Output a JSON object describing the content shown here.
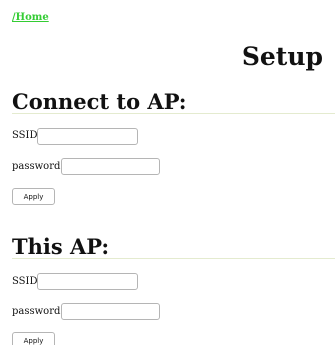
{
  "nav": {
    "home_link": "/Home"
  },
  "page": {
    "title": "Setup"
  },
  "sections": [
    {
      "heading": "Connect to AP:",
      "ssid_label": "SSID:",
      "ssid_value": "",
      "password_label": "password:",
      "password_value": "",
      "apply_label": "Apply"
    },
    {
      "heading": "This AP:",
      "ssid_label": "SSID:",
      "ssid_value": "",
      "password_label": "password:",
      "password_value": "",
      "apply_label": "Apply"
    }
  ],
  "colors": {
    "link": "#33cc33",
    "rule": "#e4ebcf",
    "field_border": "#b5b5b5"
  }
}
